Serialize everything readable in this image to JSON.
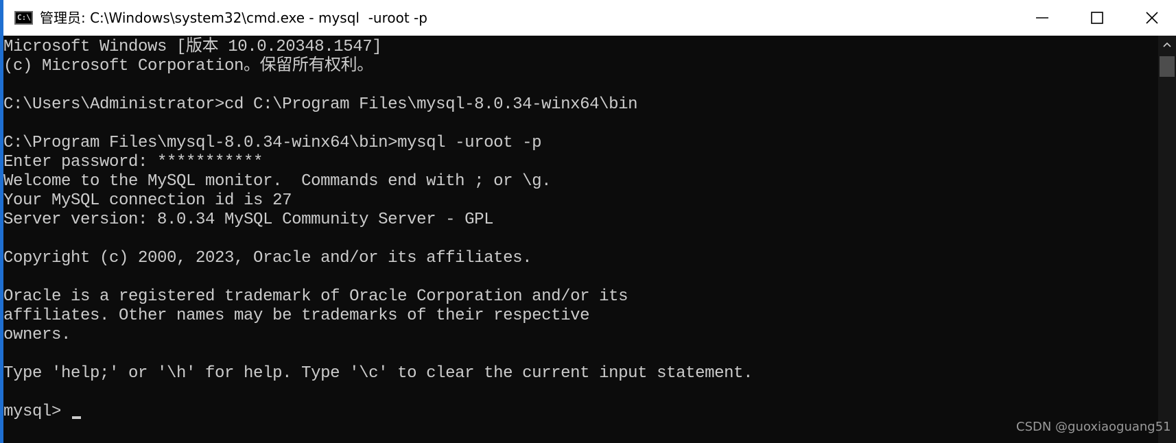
{
  "window": {
    "title": "管理员: C:\\Windows\\system32\\cmd.exe - mysql  -uroot -p",
    "icon_label": "C:\\",
    "icon": "cmd-icon",
    "controls": {
      "minimize": "minimize-icon",
      "maximize": "maximize-icon",
      "close": "close-icon"
    }
  },
  "terminal": {
    "lines": [
      "Microsoft Windows [版本 10.0.20348.1547]",
      "(c) Microsoft Corporation。保留所有权利。",
      "",
      "C:\\Users\\Administrator>cd C:\\Program Files\\mysql-8.0.34-winx64\\bin",
      "",
      "C:\\Program Files\\mysql-8.0.34-winx64\\bin>mysql -uroot -p",
      "Enter password: ***********",
      "Welcome to the MySQL monitor.  Commands end with ; or \\g.",
      "Your MySQL connection id is 27",
      "Server version: 8.0.34 MySQL Community Server - GPL",
      "",
      "Copyright (c) 2000, 2023, Oracle and/or its affiliates.",
      "",
      "Oracle is a registered trademark of Oracle Corporation and/or its",
      "affiliates. Other names may be trademarks of their respective",
      "owners.",
      "",
      "Type 'help;' or '\\h' for help. Type '\\c' to clear the current input statement.",
      "",
      "mysql> "
    ],
    "text_color": "#cccccc",
    "background": "#0c0c0c"
  },
  "watermark": "CSDN @guoxiaoguang51"
}
